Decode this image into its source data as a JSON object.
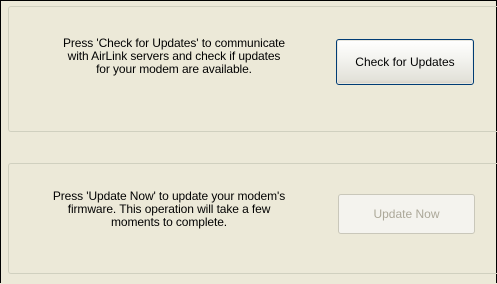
{
  "check_section": {
    "description_lines": [
      "Press 'Check for Updates' to communicate",
      "with AirLink servers and check if updates",
      "for your modem are available."
    ],
    "button_label": "Check for Updates"
  },
  "update_section": {
    "description_lines": [
      "Press 'Update Now' to update your modem's",
      "firmware. This operation will take a few",
      "moments to complete."
    ],
    "button_label": "Update Now",
    "button_enabled": false
  },
  "colors": {
    "background": "#ece9d8",
    "group_border": "#d0d0bf",
    "button_border_active": "#003c74",
    "disabled_text": "#aca899"
  }
}
